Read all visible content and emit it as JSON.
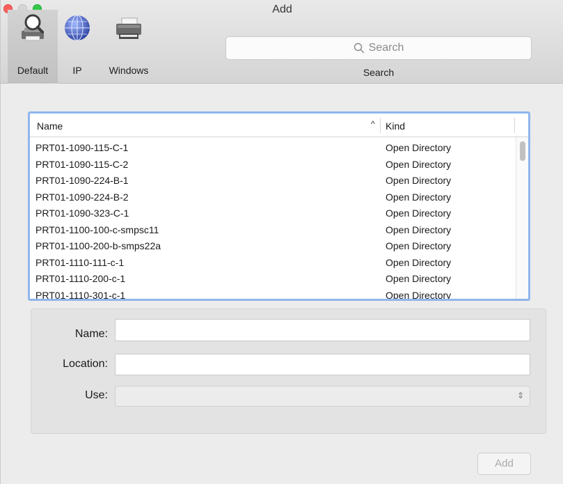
{
  "window": {
    "title": "Add",
    "colors": {
      "close": "#fc605c",
      "minimize": "#d6d6d6",
      "zoom": "#34c84a",
      "focus": "#8fb6ec"
    }
  },
  "toolbar": {
    "tools": [
      {
        "label": "Default",
        "icon": "default-printer-magnifier-icon",
        "selected": true
      },
      {
        "label": "IP",
        "icon": "globe-network-icon",
        "selected": false
      },
      {
        "label": "Windows",
        "icon": "windows-printer-icon",
        "selected": false
      }
    ],
    "search": {
      "placeholder": "Search",
      "caption": "Search",
      "icon": "search-icon"
    }
  },
  "list": {
    "columns": {
      "name": "Name",
      "kind": "Kind"
    },
    "sort_indicator": "^",
    "rows": [
      {
        "name": "PRT01-1090-115-C-1",
        "kind": "Open Directory"
      },
      {
        "name": "PRT01-1090-115-C-2",
        "kind": "Open Directory"
      },
      {
        "name": "PRT01-1090-224-B-1",
        "kind": "Open Directory"
      },
      {
        "name": "PRT01-1090-224-B-2",
        "kind": "Open Directory"
      },
      {
        "name": "PRT01-1090-323-C-1",
        "kind": "Open Directory"
      },
      {
        "name": "PRT01-1100-100-c-smpsc11",
        "kind": "Open Directory"
      },
      {
        "name": "PRT01-1100-200-b-smps22a",
        "kind": "Open Directory"
      },
      {
        "name": "PRT01-1110-111-c-1",
        "kind": "Open Directory"
      },
      {
        "name": "PRT01-1110-200-c-1",
        "kind": "Open Directory"
      },
      {
        "name": "PRT01-1110-301-c-1",
        "kind": "Open Directory"
      }
    ]
  },
  "details": {
    "name_label": "Name:",
    "name_value": "",
    "location_label": "Location:",
    "location_value": "",
    "use_label": "Use:",
    "use_value": ""
  },
  "footer": {
    "add_label": "Add"
  }
}
